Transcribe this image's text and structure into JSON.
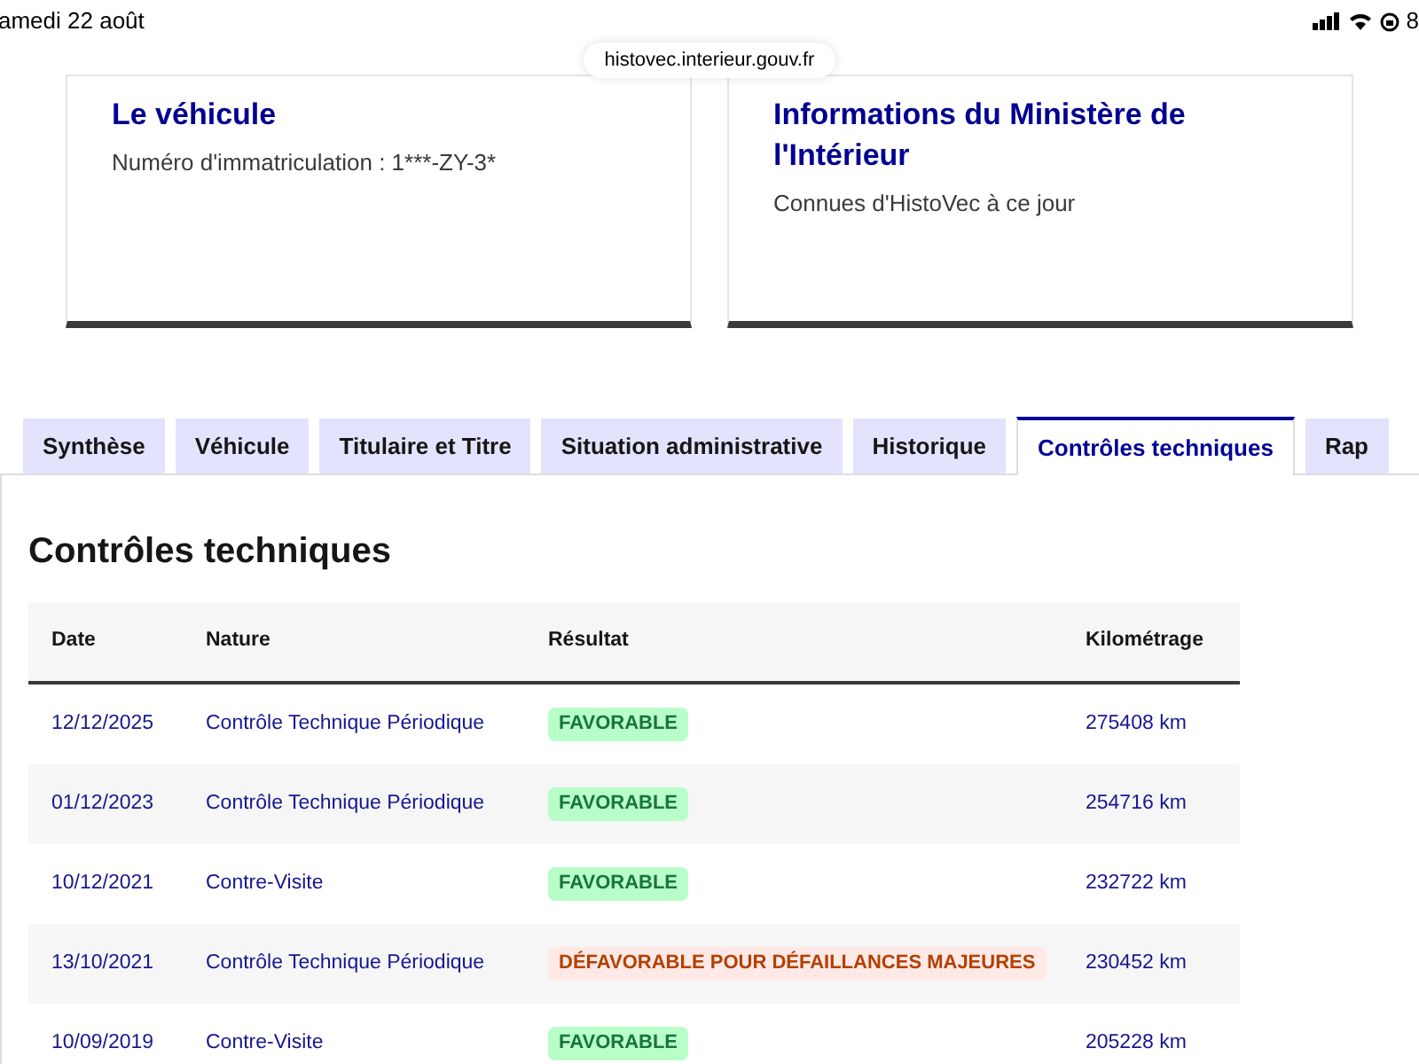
{
  "status_bar": {
    "date": "amedi 22 août",
    "battery": "8"
  },
  "address_bar": {
    "url": "histovec.interieur.gouv.fr"
  },
  "cards": [
    {
      "title": "Le véhicule",
      "text": "Numéro d'immatriculation : 1***-ZY-3*"
    },
    {
      "title": "Informations du Ministère de l'Intérieur",
      "text": "Connues d'HistoVec à ce jour"
    }
  ],
  "tabs": [
    {
      "label": "Synthèse",
      "selected": false
    },
    {
      "label": "Véhicule",
      "selected": false
    },
    {
      "label": "Titulaire et Titre",
      "selected": false
    },
    {
      "label": "Situation administrative",
      "selected": false
    },
    {
      "label": "Historique",
      "selected": false
    },
    {
      "label": "Contrôles techniques",
      "selected": true
    },
    {
      "label": "Rap",
      "selected": false
    }
  ],
  "section_title": "Contrôles techniques",
  "table": {
    "columns": [
      "Date",
      "Nature",
      "Résultat",
      "Kilométrage"
    ],
    "rows": [
      {
        "date": "12/12/2025",
        "nature": "Contrôle Technique Périodique",
        "result": "FAVORABLE",
        "kind": "favorable",
        "km": "275408 km"
      },
      {
        "date": "01/12/2023",
        "nature": "Contrôle Technique Périodique",
        "result": "FAVORABLE",
        "kind": "favorable",
        "km": "254716 km"
      },
      {
        "date": "10/12/2021",
        "nature": "Contre-Visite",
        "result": "FAVORABLE",
        "kind": "favorable",
        "km": "232722 km"
      },
      {
        "date": "13/10/2021",
        "nature": "Contrôle Technique Périodique",
        "result": "DÉFAVORABLE POUR DÉFAILLANCES MAJEURES",
        "kind": "defavorable",
        "km": "230452 km"
      },
      {
        "date": "10/09/2019",
        "nature": "Contre-Visite",
        "result": "FAVORABLE",
        "kind": "favorable",
        "km": "205228 km"
      }
    ]
  }
}
